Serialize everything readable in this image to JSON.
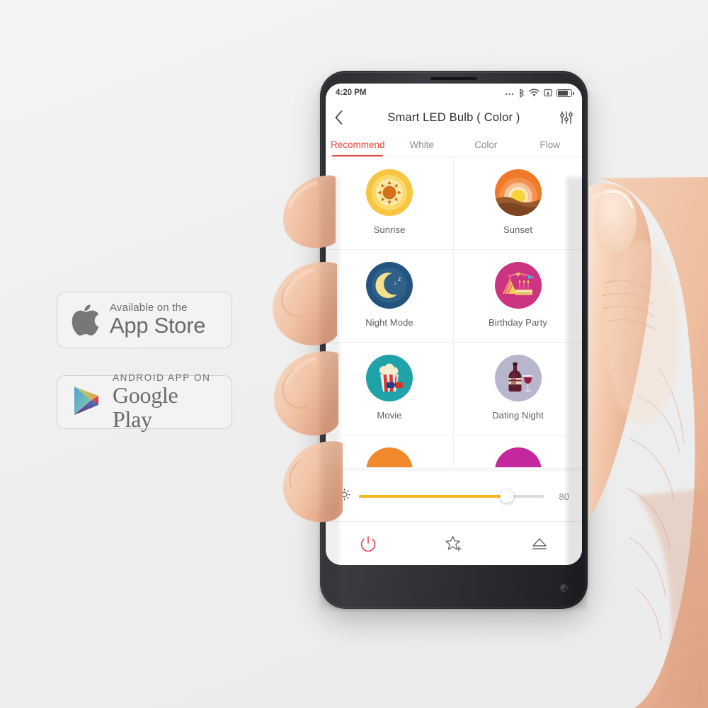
{
  "badges": {
    "appstore": {
      "name": "appstore-badge",
      "line1": "Available on the",
      "line2": "App Store",
      "icon": "apple-logo-icon"
    },
    "googleplay": {
      "name": "googleplay-badge",
      "line1": "ANDROID APP ON",
      "line2": "Google Play",
      "icon": "google-play-triangle-icon"
    }
  },
  "phone": {
    "statusbar": {
      "time": "4:20 PM",
      "icons": [
        "more-dots-icon",
        "bluetooth-icon",
        "wifi-icon",
        "alarm-icon",
        "battery-icon"
      ],
      "battery_percent": 78
    },
    "appbar": {
      "back_icon": "chevron-left-icon",
      "title": "Smart LED Bulb ( Color )",
      "settings_icon": "sliders-icon"
    },
    "tabs": [
      {
        "label": "Recommend",
        "active": true
      },
      {
        "label": "White",
        "active": false
      },
      {
        "label": "Color",
        "active": false
      },
      {
        "label": "Flow",
        "active": false
      }
    ],
    "scenes": [
      {
        "label": "Sunrise",
        "icon": "sunrise-icon",
        "color": "#f5c33c"
      },
      {
        "label": "Sunset",
        "icon": "sunset-icon",
        "color": "#ef7b2c"
      },
      {
        "label": "Night Mode",
        "icon": "night-mode-icon",
        "color": "#28527a"
      },
      {
        "label": "Birthday Party",
        "icon": "birthday-party-icon",
        "color": "#cc3380"
      },
      {
        "label": "Movie",
        "icon": "movie-icon",
        "color": "#1fa3a8"
      },
      {
        "label": "Dating Night",
        "icon": "dating-night-icon",
        "color": "#b8b6cd"
      },
      {
        "label": "",
        "icon": "partial-orange-icon",
        "color": "#f08a2c"
      },
      {
        "label": "",
        "icon": "partial-magenta-icon",
        "color": "#c4289c"
      }
    ],
    "brightness": {
      "icon": "brightness-sun-icon",
      "value": "80",
      "percent": 80,
      "fill_color": "#f5b521",
      "track_color": "#dcdcdc"
    },
    "toolbar": [
      {
        "label": "Power",
        "icon": "power-icon",
        "color": "#e8465a"
      },
      {
        "label": "Favorite",
        "icon": "star-plus-icon",
        "color": "#5e5e5e"
      },
      {
        "label": "Eject",
        "icon": "eject-icon",
        "color": "#5e5e5e"
      }
    ]
  },
  "theme": {
    "accent": "#e8463f",
    "amber": "#f5b521",
    "background": "#f2f2f2",
    "phone_body": "#2b2d31",
    "skin": "#f0c4ab"
  }
}
